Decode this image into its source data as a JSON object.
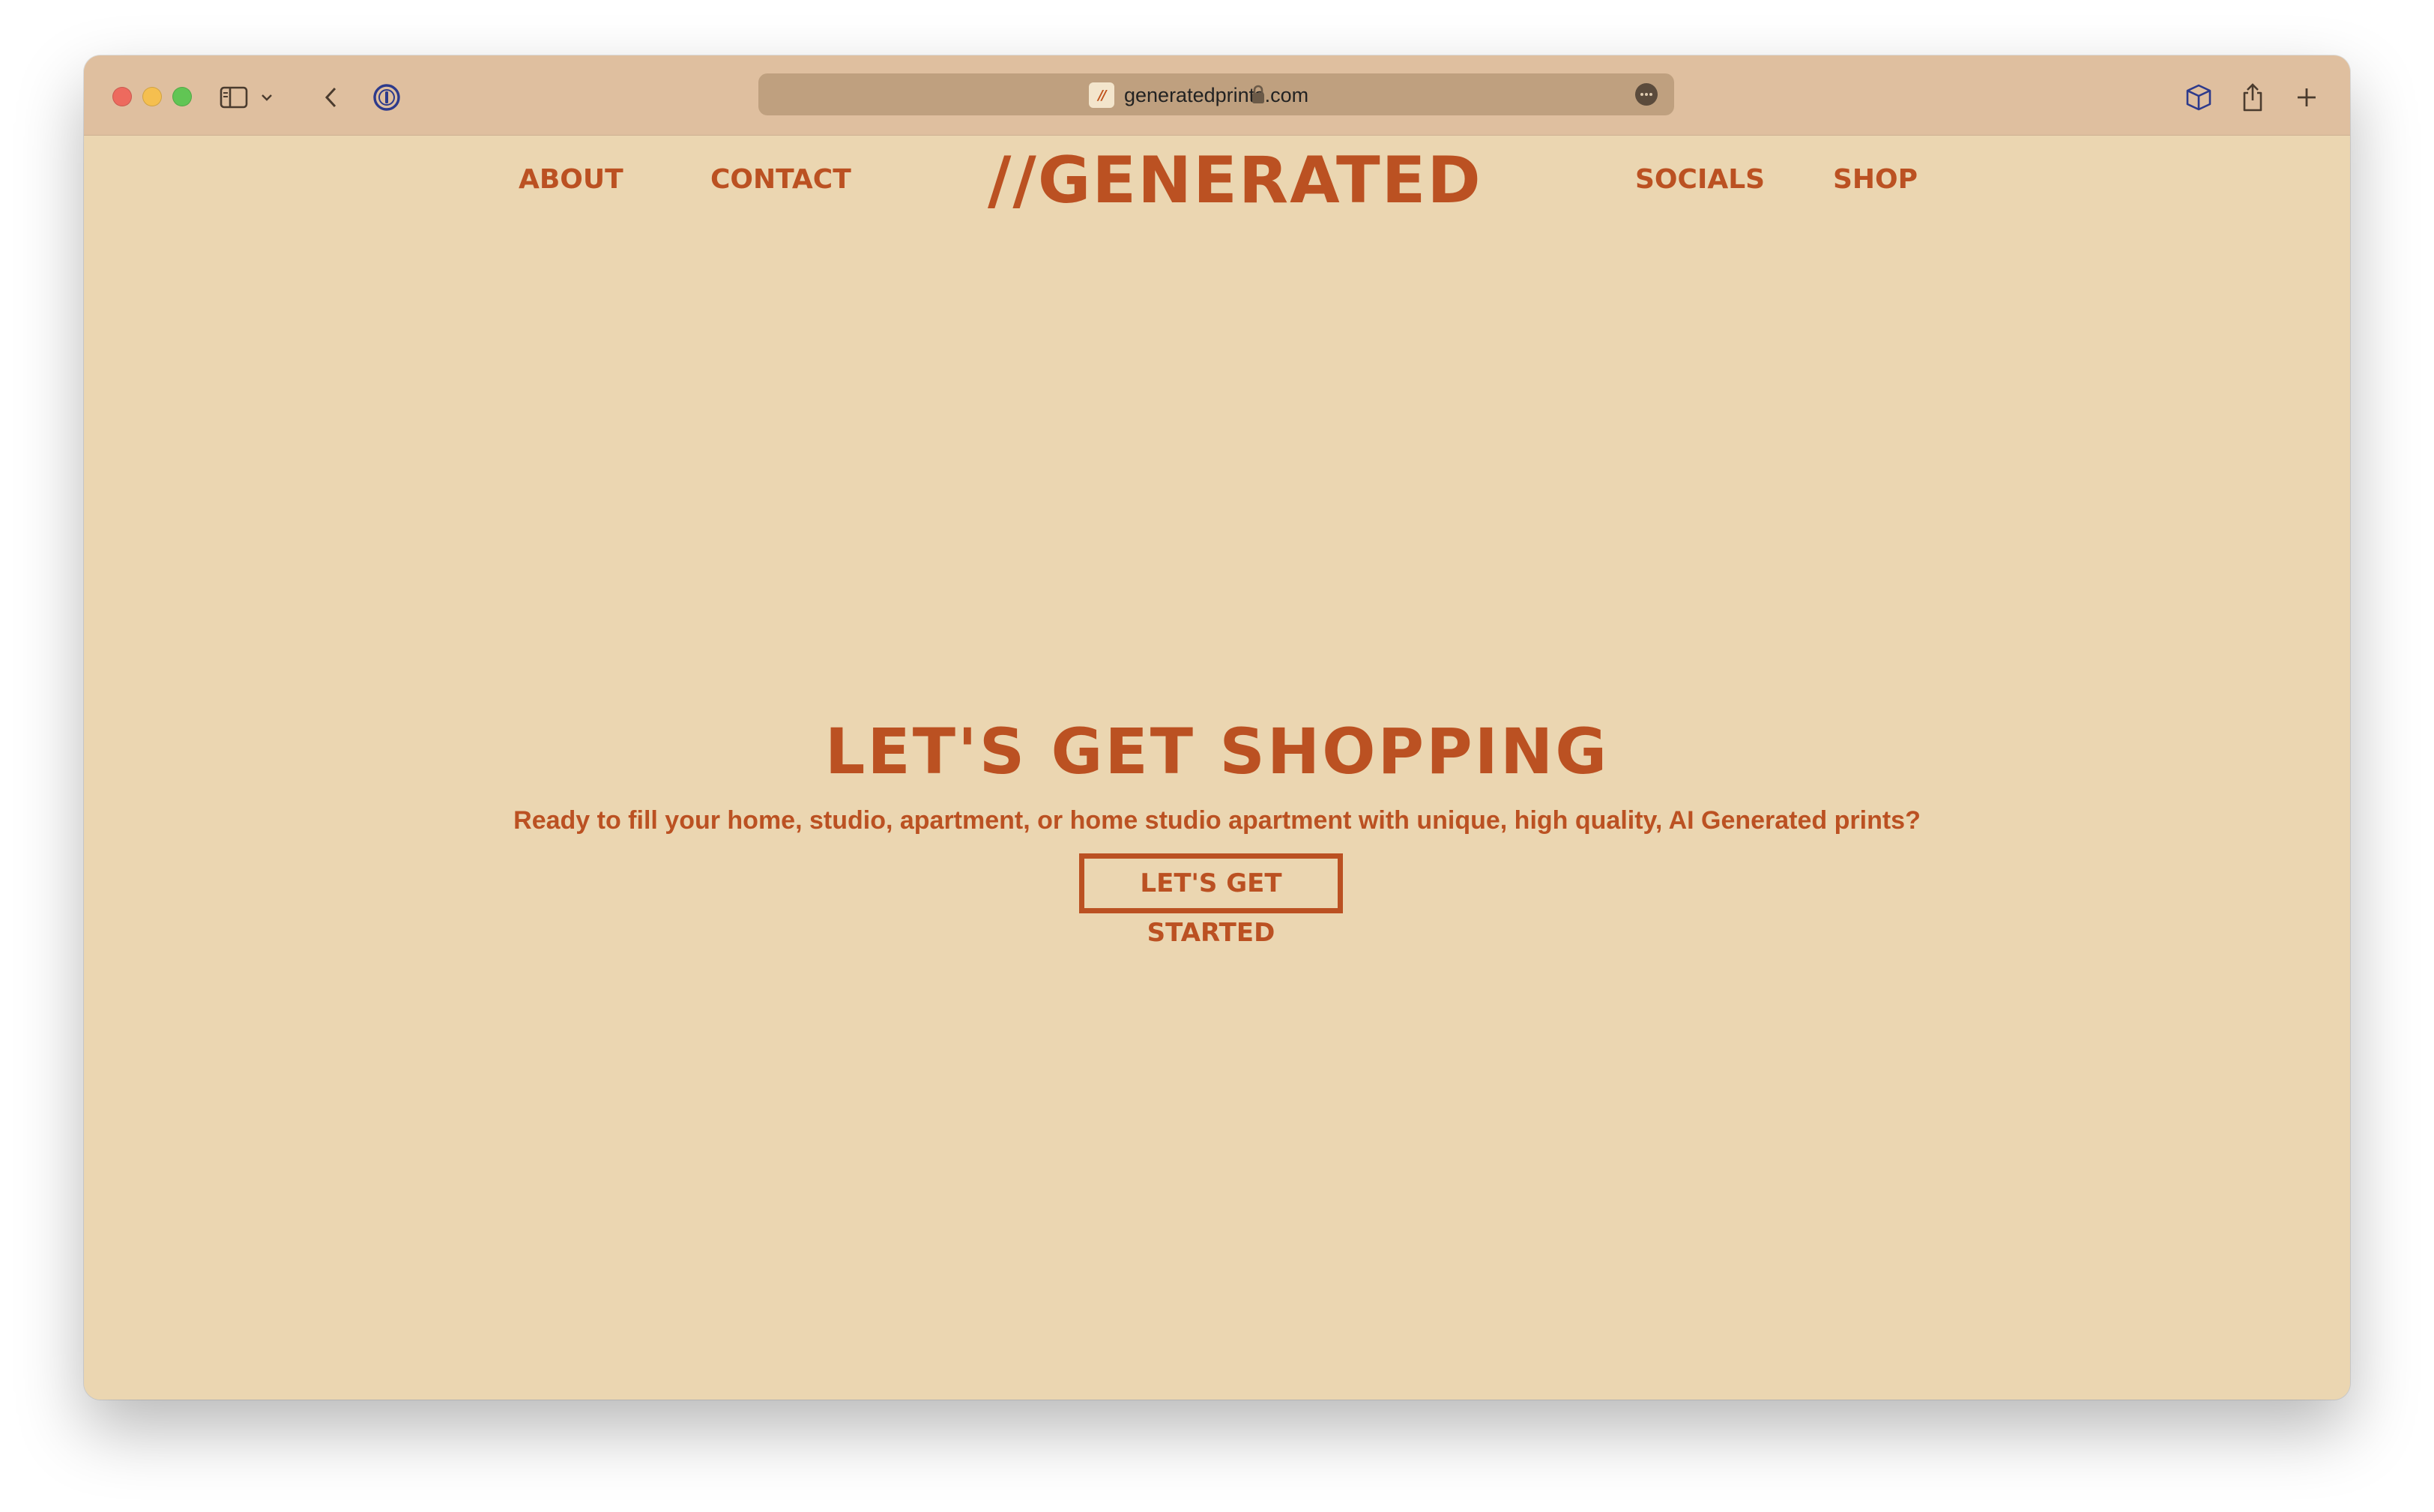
{
  "browser": {
    "url": "generatedprints.com",
    "favicon_text": "//",
    "icons": {
      "sidebar": "sidebar-icon",
      "chevron": "chevron-down-icon",
      "back": "back-arrow-icon",
      "password_manager": "1password-icon",
      "lock": "lock-icon",
      "more": "ellipsis-circle-icon",
      "extension": "box-icon",
      "share": "share-icon",
      "new_tab": "plus-icon"
    }
  },
  "site": {
    "logo": "//GENERATED",
    "nav": {
      "about": "ABOUT",
      "contact": "CONTACT",
      "socials": "SOCIALS",
      "shop": "SHOP"
    },
    "hero": {
      "title": "LET'S GET SHOPPING",
      "subtitle": "Ready to fill your home, studio, apartment, or home studio apartment with unique, high quality, AI Generated prints?",
      "cta": "LET'S GET STARTED"
    },
    "colors": {
      "accent": "#bb5122",
      "background": "#ebd6b1",
      "toolbar": "#dfbf9f"
    }
  }
}
